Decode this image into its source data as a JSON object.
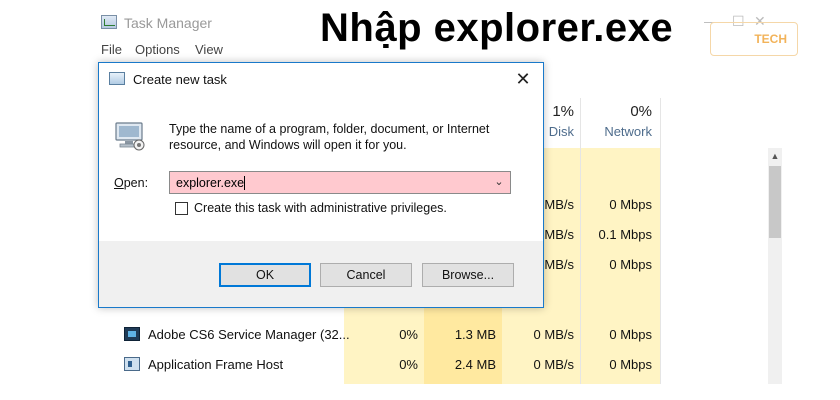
{
  "caption": "Nhập explorer.exe",
  "task_manager": {
    "title": "Task Manager",
    "controls": {
      "minimize": "—",
      "maximize": "☐",
      "close": "✕"
    },
    "menu": [
      "File",
      "Options",
      "View"
    ],
    "brand_text": "TECH",
    "columns": [
      {
        "pct": "1%",
        "name": "Disk"
      },
      {
        "pct": "0%",
        "name": "Network"
      }
    ],
    "rows_partial": [
      {
        "disk": "MB/s",
        "network": "0 Mbps"
      },
      {
        "disk": "MB/s",
        "network": "0.1 Mbps"
      },
      {
        "disk": "MB/s",
        "network": "0 Mbps"
      }
    ],
    "processes": [
      {
        "name": "Adobe CS6 Service Manager (32...",
        "cpu": "0%",
        "memory": "1.3 MB",
        "disk": "0 MB/s",
        "network": "0 Mbps",
        "icon": "adobe-icon"
      },
      {
        "name": "Application Frame Host",
        "cpu": "0%",
        "memory": "2.4 MB",
        "disk": "0 MB/s",
        "network": "0 Mbps",
        "icon": "app-frame-icon"
      }
    ]
  },
  "dialog": {
    "title": "Create new task",
    "description": "Type the name of a program, folder, document, or Internet resource, and Windows will open it for you.",
    "open_label_accel": "O",
    "open_label_rest": "pen:",
    "open_value": "explorer.exe",
    "admin_label": "Create this task with administrative privileges.",
    "buttons": {
      "ok": "OK",
      "cancel": "Cancel",
      "browse": "Browse..."
    },
    "close_glyph": "✕"
  }
}
